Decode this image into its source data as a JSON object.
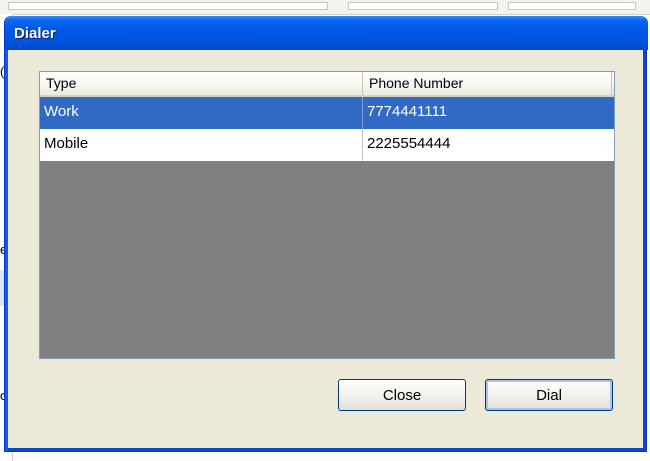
{
  "window": {
    "title": "Dialer"
  },
  "table": {
    "columns": [
      "Type",
      "Phone Number"
    ],
    "rows": [
      {
        "type": "Work",
        "phone": "7774441111",
        "selected": true
      },
      {
        "type": "Mobile",
        "phone": "2225554444",
        "selected": false
      }
    ]
  },
  "buttons": {
    "close_label": "Close",
    "dial_label": "Dial"
  },
  "background": {
    "left_fragments": [
      "(",
      "e",
      "ol"
    ]
  },
  "colors": {
    "titlebar": "#0054e3",
    "selection": "#316ac5",
    "list_background": "#808080",
    "dialog_face": "#ece9d8"
  }
}
